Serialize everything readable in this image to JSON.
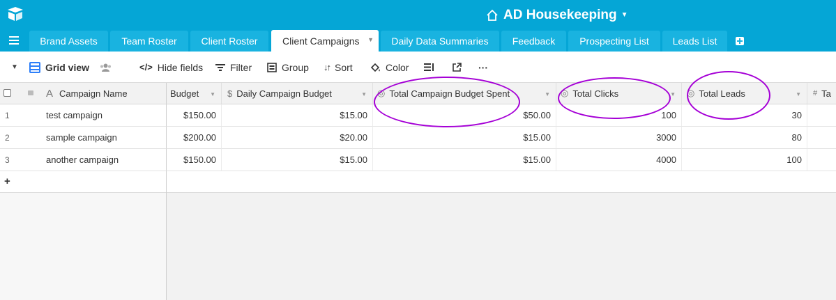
{
  "base": {
    "title": "AD Housekeeping"
  },
  "tabs": [
    {
      "label": "Brand Assets"
    },
    {
      "label": "Team Roster"
    },
    {
      "label": "Client Roster"
    },
    {
      "label": "Client Campaigns",
      "active": true
    },
    {
      "label": "Daily Data Summaries"
    },
    {
      "label": "Feedback"
    },
    {
      "label": "Prospecting List"
    },
    {
      "label": "Leads List"
    }
  ],
  "viewbar": {
    "view_name": "Grid view",
    "hide_fields": "Hide fields",
    "filter": "Filter",
    "group": "Group",
    "sort": "Sort",
    "color": "Color",
    "more": "···"
  },
  "columns": {
    "primary": "Campaign Name",
    "budget": "Budget",
    "daily_budget": "Daily Campaign Budget",
    "spent": "Total Campaign Budget Spent",
    "clicks": "Total Clicks",
    "leads": "Total Leads",
    "next": "Ta"
  },
  "rows": [
    {
      "num": "1",
      "name": "test campaign",
      "budget": "$150.00",
      "daily": "$15.00",
      "spent": "$50.00",
      "clicks": "100",
      "leads": "30"
    },
    {
      "num": "2",
      "name": "sample campaign",
      "budget": "$200.00",
      "daily": "$20.00",
      "spent": "$15.00",
      "clicks": "3000",
      "leads": "80"
    },
    {
      "num": "3",
      "name": "another campaign",
      "budget": "$150.00",
      "daily": "$15.00",
      "spent": "$15.00",
      "clicks": "4000",
      "leads": "100"
    }
  ],
  "add_row": "+",
  "colors": {
    "topbar": "#05a6d6",
    "tab": "#19b3e0",
    "annotation": "#a500d6",
    "accent": "#2d7ff9"
  },
  "icons": [
    "airtable-logo-icon",
    "home-icon",
    "hamburger-icon",
    "add-tab-icon",
    "grid-view-icon",
    "collaborators-icon",
    "hide-fields-icon",
    "filter-icon",
    "group-icon",
    "sort-icon",
    "color-icon",
    "row-height-icon",
    "share-icon",
    "more-icon"
  ]
}
